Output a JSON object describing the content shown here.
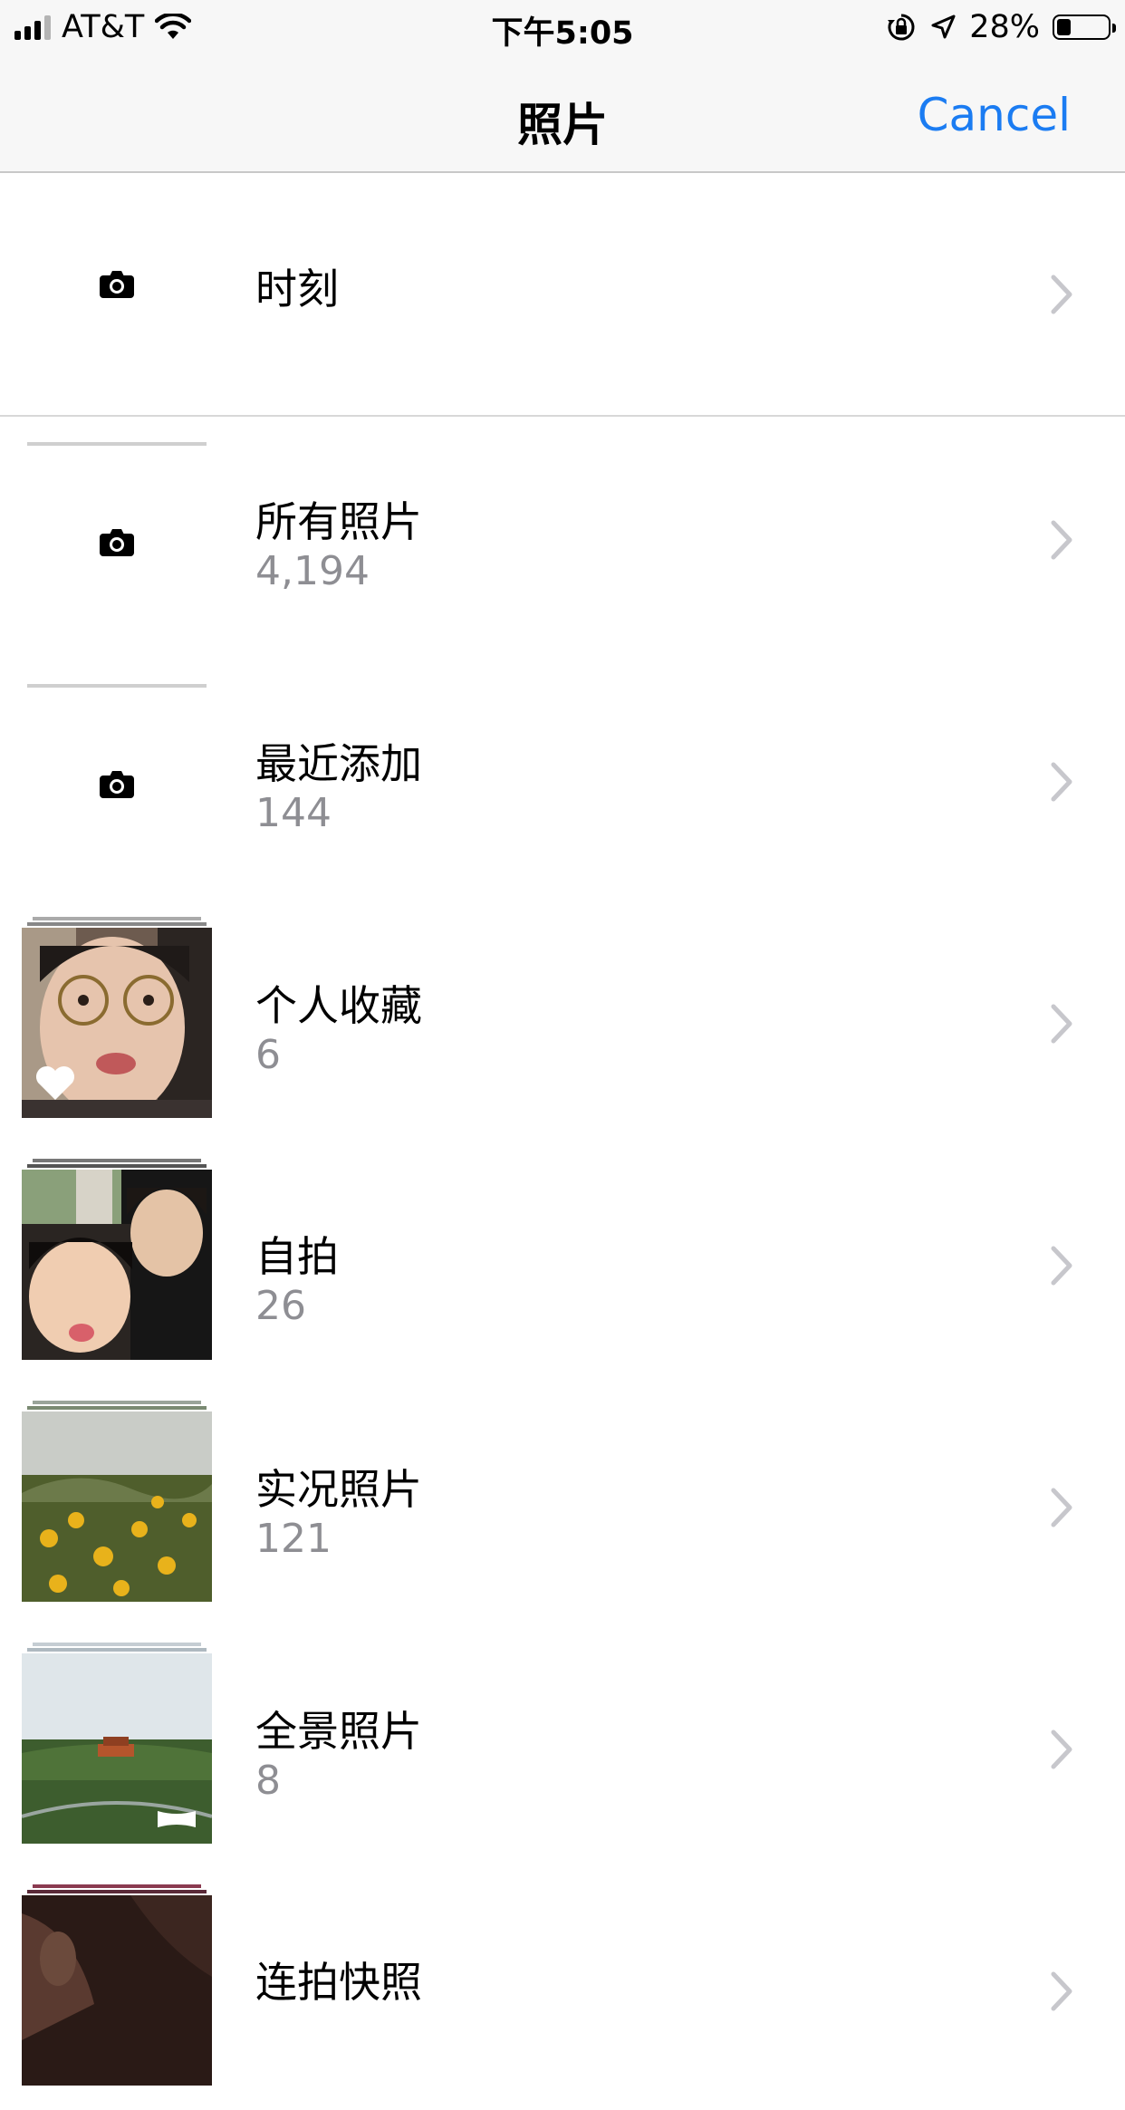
{
  "status_bar": {
    "carrier": "AT&T",
    "time": "下午5:05",
    "battery_percent": "28%",
    "battery_level": 0.28
  },
  "nav": {
    "title": "照片",
    "cancel_label": "Cancel"
  },
  "albums": [
    {
      "title": "时刻",
      "count": ""
    },
    {
      "title": "所有照片",
      "count": "4,194"
    },
    {
      "title": "最近添加",
      "count": "144"
    },
    {
      "title": "个人收藏",
      "count": "6"
    },
    {
      "title": "自拍",
      "count": "26"
    },
    {
      "title": "实况照片",
      "count": "121"
    },
    {
      "title": "全景照片",
      "count": "8"
    },
    {
      "title": "连拍快照",
      "count": ""
    }
  ],
  "colors": {
    "accent": "#1b7cf2",
    "secondary_text": "#8e8e93",
    "bar_background": "#f7f7f7"
  }
}
